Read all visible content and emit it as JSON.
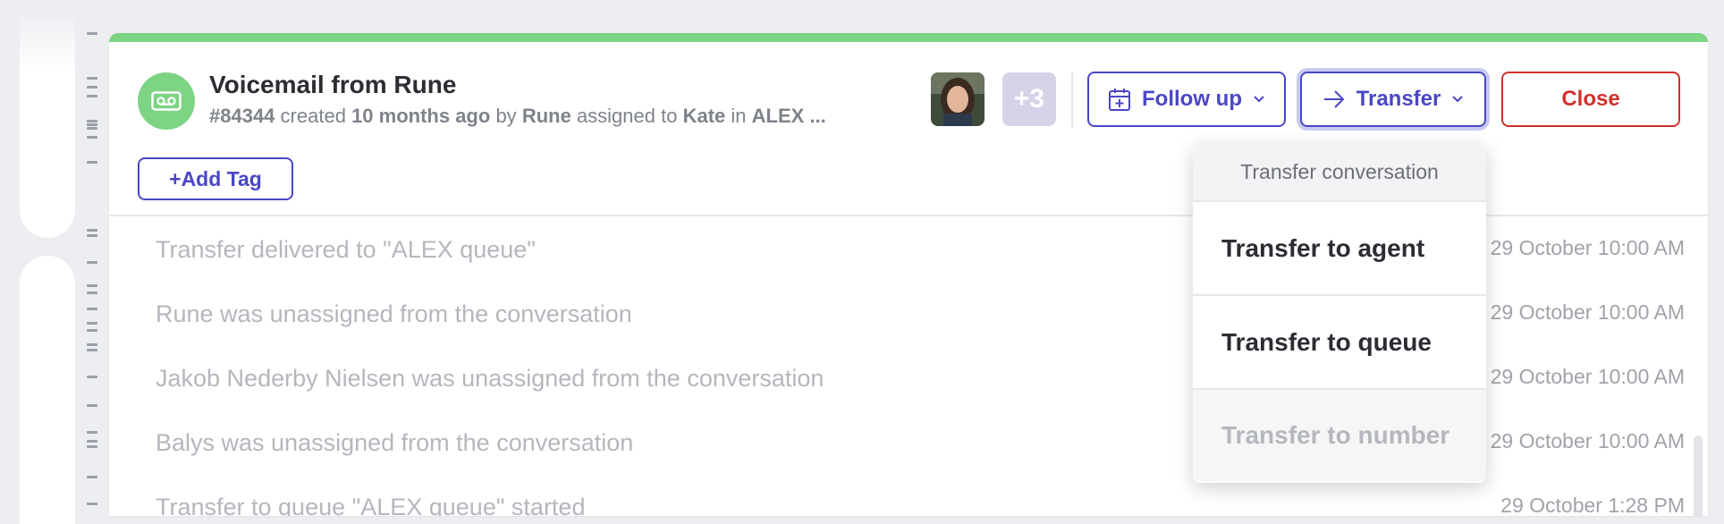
{
  "conversation": {
    "title": "Voicemail from Rune",
    "id": "#84344",
    "created_word": "created",
    "created_ago": "10 months ago",
    "by_word": "by",
    "creator": "Rune",
    "assigned_word": "assigned to",
    "assignee": "Kate",
    "in_word": "in",
    "queue": "ALEX ...",
    "extra_participants": "+3"
  },
  "toolbar": {
    "follow_up_label": "Follow up",
    "transfer_label": "Transfer",
    "close_label": "Close"
  },
  "tags": {
    "add_tag_label": "+Add Tag"
  },
  "activity": [
    {
      "text": "Transfer delivered to \"ALEX queue\"",
      "time": "29 October 10:00 AM"
    },
    {
      "text": "Rune was unassigned from the conversation",
      "time": "29 October 10:00 AM"
    },
    {
      "text": "Jakob Nederby Nielsen was unassigned from the conversation",
      "time": "29 October 10:00 AM"
    },
    {
      "text": "Balys was unassigned from the conversation",
      "time": "29 October 10:00 AM"
    },
    {
      "text": "Transfer to queue \"ALEX queue\" started",
      "time": "29 October 1:28 PM"
    }
  ],
  "transfer_menu": {
    "header": "Transfer conversation",
    "items": [
      {
        "label": "Transfer to agent",
        "enabled": true
      },
      {
        "label": "Transfer to queue",
        "enabled": true
      },
      {
        "label": "Transfer to number",
        "enabled": false
      }
    ]
  },
  "colors": {
    "accent": "#4a47c5",
    "status_bar": "#7dd483",
    "close": "#d0312d"
  },
  "icons": {
    "header": "voicemail-icon",
    "follow_up": "calendar-plus-icon",
    "transfer": "arrow-right-icon",
    "dropdown": "chevron-down-icon"
  }
}
